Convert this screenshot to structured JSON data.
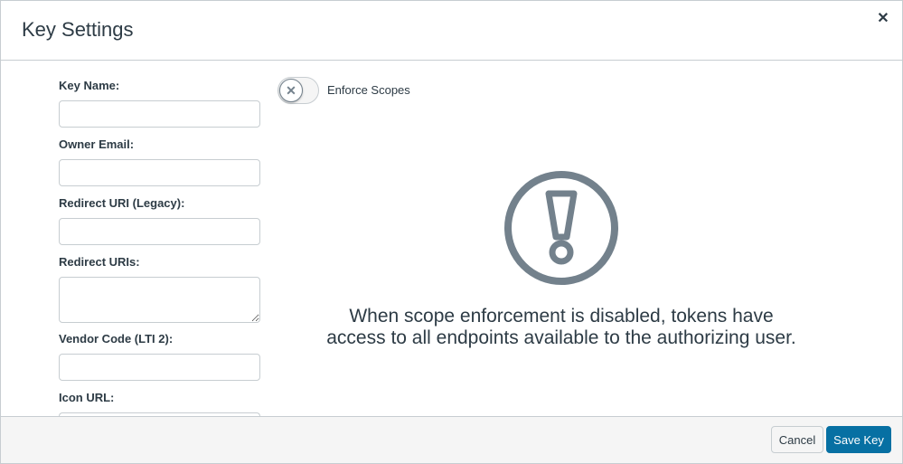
{
  "modal": {
    "title": "Key Settings",
    "close_icon": "close-icon"
  },
  "form": {
    "key_name": {
      "label": "Key Name:",
      "value": "",
      "placeholder": ""
    },
    "owner_email": {
      "label": "Owner Email:",
      "value": "",
      "placeholder": ""
    },
    "redirect_uri_legacy": {
      "label": "Redirect URI (Legacy):",
      "value": "",
      "placeholder": ""
    },
    "redirect_uris": {
      "label": "Redirect URIs:",
      "value": "",
      "placeholder": ""
    },
    "vendor_code": {
      "label": "Vendor Code (LTI 2):",
      "value": "",
      "placeholder": ""
    },
    "icon_url": {
      "label": "Icon URL:",
      "value": "",
      "placeholder": ""
    }
  },
  "scopes": {
    "toggle_label": "Enforce Scopes",
    "toggle_state": "off",
    "toggle_icon": "x-icon",
    "warning_icon": "exclamation-circle-icon",
    "warning_text": "When scope enforcement is disabled, tokens have access to all endpoints available to the authorizing user."
  },
  "footer": {
    "cancel_label": "Cancel",
    "save_label": "Save Key"
  },
  "colors": {
    "primary": "#0770a3",
    "text": "#2d3b45",
    "border": "#c7cdd1",
    "icon_gray": "#73818c",
    "footer_bg": "#f5f5f5"
  }
}
